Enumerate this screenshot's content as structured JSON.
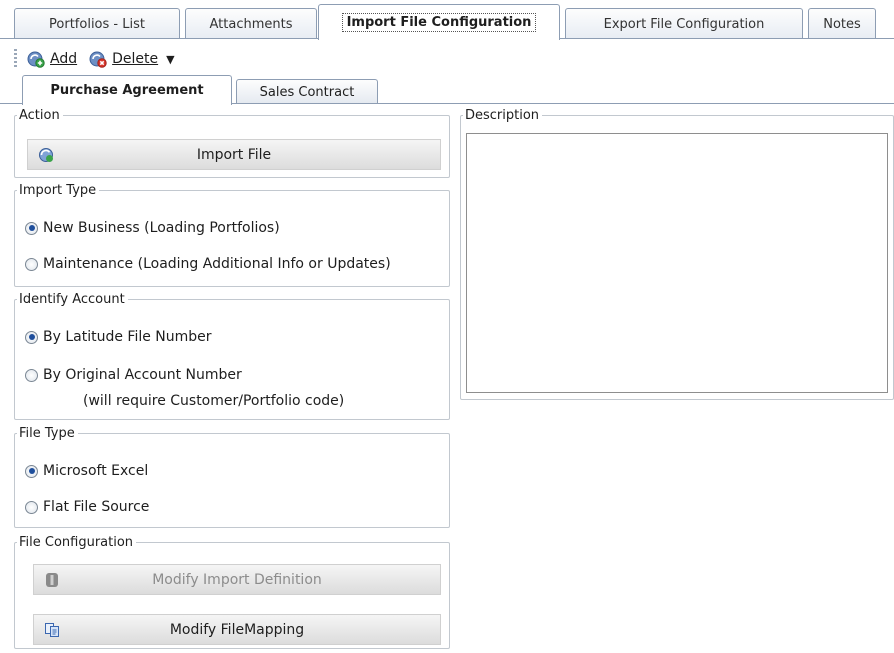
{
  "top_tabs": [
    "Portfolios - List",
    "Attachments",
    "Import File Configuration",
    "Export File Configuration",
    "Notes"
  ],
  "toolbar": {
    "add_label": "Add",
    "delete_label": "Delete",
    "add_icon": "add-icon",
    "delete_icon": "delete-icon"
  },
  "sub_tabs": [
    "Purchase Agreement",
    "Sales Contract"
  ],
  "action": {
    "legend": "Action",
    "import_file_label": "Import File"
  },
  "import_type": {
    "legend": "Import Type",
    "new_business": "New Business (Loading Portfolios)",
    "maintenance": "Maintenance (Loading Additional Info or Updates)",
    "selected": "new_business"
  },
  "identify_account": {
    "legend": "Identify Account",
    "latitude": "By Latitude File Number",
    "original": "By Original Account Number",
    "original_note": "(will require Customer/Portfolio code)",
    "selected": "latitude"
  },
  "file_type": {
    "legend": "File Type",
    "excel": "Microsoft Excel",
    "flat": "Flat File Source",
    "selected": "excel"
  },
  "file_configuration": {
    "legend": "File Configuration",
    "modify_import": "Modify Import Definition",
    "modify_mapping": "Modify FileMapping"
  },
  "description": {
    "legend": "Description",
    "value": ""
  }
}
